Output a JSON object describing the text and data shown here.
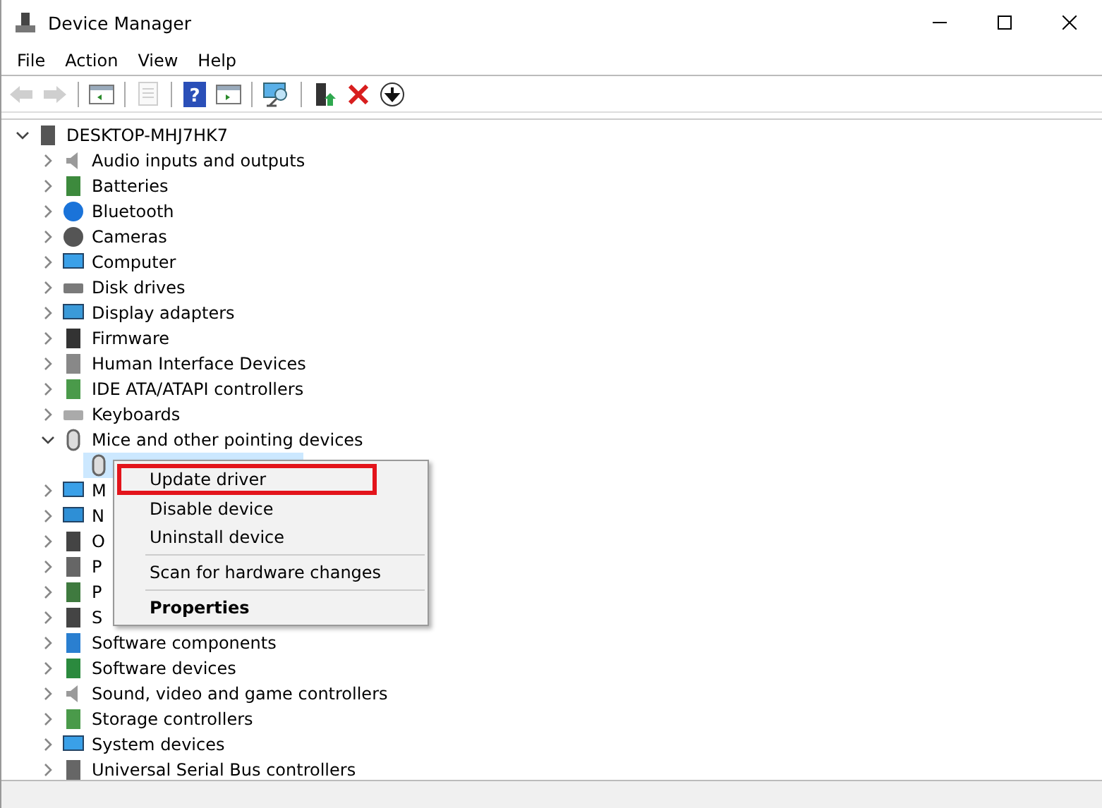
{
  "window": {
    "title": "Device Manager"
  },
  "menu_bar": [
    "File",
    "Action",
    "View",
    "Help"
  ],
  "toolbar": [
    {
      "kind": "back",
      "disabled": true
    },
    {
      "kind": "forward",
      "disabled": true
    },
    {
      "kind": "separator"
    },
    {
      "kind": "console",
      "disabled": false
    },
    {
      "kind": "separator"
    },
    {
      "kind": "properties",
      "disabled": true
    },
    {
      "kind": "separator"
    },
    {
      "kind": "help",
      "disabled": false,
      "glyph": "?"
    },
    {
      "kind": "action-pane",
      "disabled": false
    },
    {
      "kind": "separator"
    },
    {
      "kind": "scan",
      "disabled": false
    },
    {
      "kind": "separator"
    },
    {
      "kind": "update",
      "disabled": false
    },
    {
      "kind": "uninstall",
      "disabled": false
    },
    {
      "kind": "download",
      "disabled": false
    }
  ],
  "tree": {
    "label": "DESKTOP-MHJ7HK7",
    "expanded": true,
    "children": [
      {
        "label": "Audio inputs and outputs",
        "expanded": false
      },
      {
        "label": "Batteries",
        "expanded": false
      },
      {
        "label": "Bluetooth",
        "expanded": false
      },
      {
        "label": "Cameras",
        "expanded": false
      },
      {
        "label": "Computer",
        "expanded": false
      },
      {
        "label": "Disk drives",
        "expanded": false
      },
      {
        "label": "Display adapters",
        "expanded": false
      },
      {
        "label": "Firmware",
        "expanded": false
      },
      {
        "label": "Human Interface Devices",
        "expanded": false
      },
      {
        "label": "IDE ATA/ATAPI controllers",
        "expanded": false
      },
      {
        "label": "Keyboards",
        "expanded": false
      },
      {
        "label": "Mice and other pointing devices",
        "expanded": true,
        "children": [
          {
            "selected": true
          }
        ]
      },
      {
        "label": "M",
        "expanded": false
      },
      {
        "label": "N",
        "expanded": false
      },
      {
        "label": "O",
        "expanded": false
      },
      {
        "label": "P",
        "expanded": false
      },
      {
        "label": "P",
        "expanded": false
      },
      {
        "label": "S",
        "expanded": false
      },
      {
        "label": "Software components",
        "expanded": false
      },
      {
        "label": "Software devices",
        "expanded": false
      },
      {
        "label": "Sound, video and game controllers",
        "expanded": false
      },
      {
        "label": "Storage controllers",
        "expanded": false
      },
      {
        "label": "System devices",
        "expanded": false
      },
      {
        "label": "Universal Serial Bus controllers",
        "expanded": false
      }
    ]
  },
  "context_menu": [
    {
      "label": "Update driver",
      "selected": true,
      "separator_before": false,
      "default": false
    },
    {
      "label": "Disable device",
      "selected": false,
      "separator_before": false,
      "default": false
    },
    {
      "label": "Uninstall device",
      "selected": false,
      "separator_before": false,
      "default": false
    },
    {
      "label": "Scan for hardware changes",
      "selected": false,
      "separator_before": true,
      "default": false
    },
    {
      "label": "Properties",
      "selected": false,
      "separator_before": true,
      "default": true
    }
  ]
}
